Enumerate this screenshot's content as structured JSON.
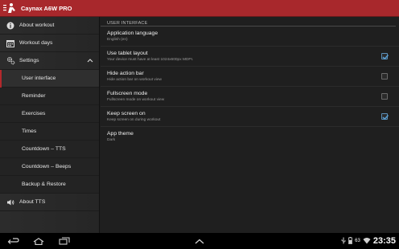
{
  "app": {
    "title": "Caynax A6W PRO"
  },
  "drawer": {
    "items": [
      {
        "label": "About workout",
        "icon": "info-icon"
      },
      {
        "label": "Workout days",
        "icon": "calendar-icon"
      },
      {
        "label": "Settings",
        "icon": "gear-icon",
        "expanded": true
      },
      {
        "label": "User interface",
        "sub": true,
        "active": true
      },
      {
        "label": "Reminder",
        "sub": true
      },
      {
        "label": "Exercises",
        "sub": true
      },
      {
        "label": "Times",
        "sub": true
      },
      {
        "label": "Countdown – TTS",
        "sub": true
      },
      {
        "label": "Countdown – Beeps",
        "sub": true
      },
      {
        "label": "Backup & Restore",
        "sub": true
      },
      {
        "label": "About TTS",
        "icon": "speaker-icon"
      }
    ]
  },
  "content": {
    "section_header": "USER INTERFACE",
    "prefs": [
      {
        "title": "Application language",
        "summary": "English (en)",
        "has_checkbox": false
      },
      {
        "title": "Use tablet layout",
        "summary": "Your device must have at least 1024x600px MDPI.",
        "has_checkbox": true,
        "checked": true
      },
      {
        "title": "Hide action bar",
        "summary": "Hide action bar on workout view",
        "has_checkbox": true,
        "checked": false
      },
      {
        "title": "Fullscreen mode",
        "summary": "Fullscreen mode on workout view",
        "has_checkbox": true,
        "checked": false
      },
      {
        "title": "Keep screen on",
        "summary": "Keep screen on during workout",
        "has_checkbox": true,
        "checked": true
      },
      {
        "title": "App theme",
        "summary": "Dark",
        "has_checkbox": false
      }
    ]
  },
  "status": {
    "battery": "63",
    "time": "23:35"
  },
  "colors": {
    "accent": "#a8282c",
    "check": "#5a8fb8"
  }
}
